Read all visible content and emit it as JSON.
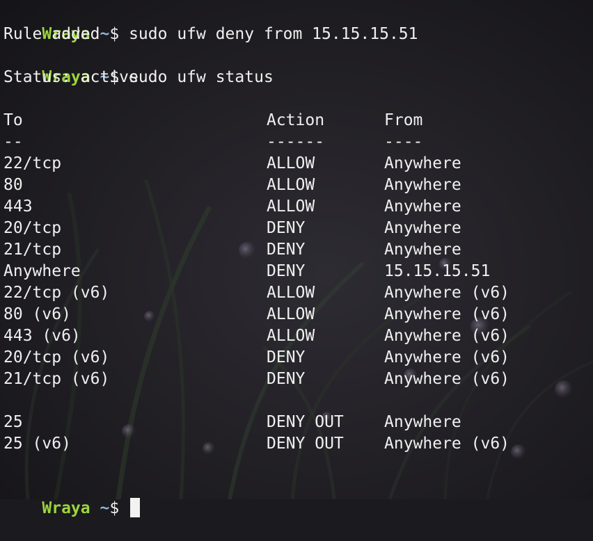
{
  "theme": {
    "text_color": "#f0f0f0",
    "prompt_user_color": "#9bd63c",
    "prompt_path_color": "#8fb3d9",
    "cursor_color": "#f2f2f2",
    "background_color": "#1b1a1e"
  },
  "prompt": {
    "user": "Wraya",
    "path": "~",
    "symbol": "$"
  },
  "session": {
    "cmd1": "sudo ufw deny from 15.15.15.51",
    "out1": "Rule added",
    "cmd2": "sudo ufw status",
    "status_line": "Status: active",
    "cmd3": ""
  },
  "table": {
    "headers": {
      "to": "To",
      "action": "Action",
      "from": "From"
    },
    "separators": {
      "to": "--",
      "action": "------",
      "from": "----"
    },
    "rows": [
      {
        "to": "22/tcp",
        "action": "ALLOW",
        "from": "Anywhere"
      },
      {
        "to": "80",
        "action": "ALLOW",
        "from": "Anywhere"
      },
      {
        "to": "443",
        "action": "ALLOW",
        "from": "Anywhere"
      },
      {
        "to": "20/tcp",
        "action": "DENY",
        "from": "Anywhere"
      },
      {
        "to": "21/tcp",
        "action": "DENY",
        "from": "Anywhere"
      },
      {
        "to": "Anywhere",
        "action": "DENY",
        "from": "15.15.15.51"
      },
      {
        "to": "22/tcp (v6)",
        "action": "ALLOW",
        "from": "Anywhere (v6)"
      },
      {
        "to": "80 (v6)",
        "action": "ALLOW",
        "from": "Anywhere (v6)"
      },
      {
        "to": "443 (v6)",
        "action": "ALLOW",
        "from": "Anywhere (v6)"
      },
      {
        "to": "20/tcp (v6)",
        "action": "DENY",
        "from": "Anywhere (v6)"
      },
      {
        "to": "21/tcp (v6)",
        "action": "DENY",
        "from": "Anywhere (v6)"
      }
    ],
    "out_rows": [
      {
        "to": "25",
        "action": "DENY OUT",
        "from": "Anywhere"
      },
      {
        "to": "25 (v6)",
        "action": "DENY OUT",
        "from": "Anywhere (v6)"
      }
    ]
  }
}
